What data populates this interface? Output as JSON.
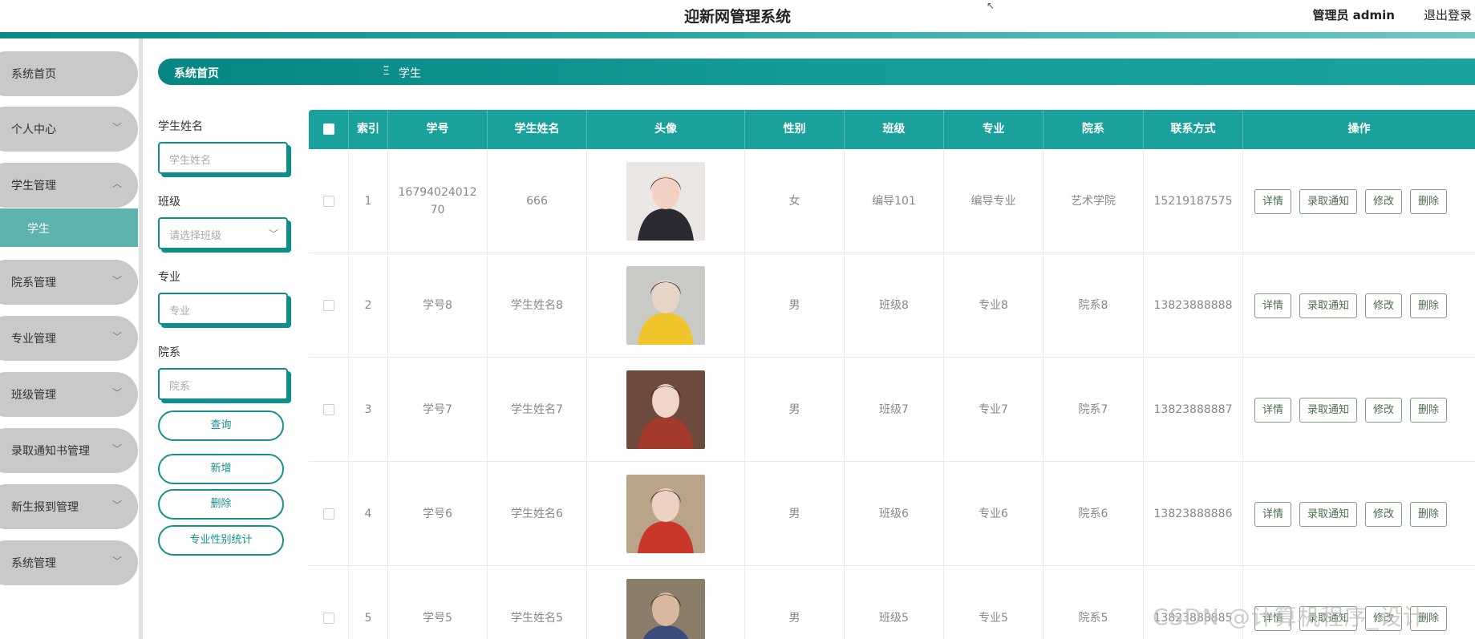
{
  "header": {
    "title": "迎新网管理系统",
    "user": "管理员 admin",
    "logout": "退出登录"
  },
  "sidebar": {
    "items": [
      {
        "label": "系统首页",
        "chevron": ""
      },
      {
        "label": "个人中心",
        "chevron": "﹀"
      },
      {
        "label": "学生管理",
        "chevron": "︿"
      },
      {
        "label": "院系管理",
        "chevron": "﹀"
      },
      {
        "label": "专业管理",
        "chevron": "﹀"
      },
      {
        "label": "班级管理",
        "chevron": "﹀"
      },
      {
        "label": "录取通知书管理",
        "chevron": "﹀"
      },
      {
        "label": "新生报到管理",
        "chevron": "﹀"
      },
      {
        "label": "系统管理",
        "chevron": "﹀"
      }
    ],
    "sub_active": "学生"
  },
  "breadcrumb": {
    "home": "系统首页",
    "sep": "Ξ",
    "current": "学生"
  },
  "search": {
    "name_label": "学生姓名",
    "name_placeholder": "学生姓名",
    "class_label": "班级",
    "class_placeholder": "请选择班级",
    "major_label": "专业",
    "major_placeholder": "专业",
    "dept_label": "院系",
    "dept_placeholder": "院系",
    "query_btn": "查询",
    "add_btn": "新增",
    "delete_btn": "删除",
    "stat_btn": "专业性别统计"
  },
  "table": {
    "headers": [
      "索引",
      "学号",
      "学生姓名",
      "头像",
      "性别",
      "班级",
      "专业",
      "院系",
      "联系方式",
      "操作"
    ],
    "actions": [
      "详情",
      "录取通知",
      "修改",
      "删除"
    ],
    "rows": [
      {
        "index": "1",
        "id": "1679402401270",
        "name": "666",
        "gender": "女",
        "class": "编导101",
        "major": "编导专业",
        "dept": "艺术学院",
        "phone": "15219187575"
      },
      {
        "index": "2",
        "id": "学号8",
        "name": "学生姓名8",
        "gender": "男",
        "class": "班级8",
        "major": "专业8",
        "dept": "院系8",
        "phone": "13823888888"
      },
      {
        "index": "3",
        "id": "学号7",
        "name": "学生姓名7",
        "gender": "男",
        "class": "班级7",
        "major": "专业7",
        "dept": "院系7",
        "phone": "13823888887"
      },
      {
        "index": "4",
        "id": "学号6",
        "name": "学生姓名6",
        "gender": "男",
        "class": "班级6",
        "major": "专业6",
        "dept": "院系6",
        "phone": "13823888886"
      },
      {
        "index": "5",
        "id": "学号5",
        "name": "学生姓名5",
        "gender": "男",
        "class": "班级5",
        "major": "专业5",
        "dept": "院系5",
        "phone": "13823888885"
      }
    ]
  },
  "watermark": "CSDN @计算机程序_设计",
  "colors": {
    "accent": "#1aa19c",
    "accent_dark": "#0b8a85",
    "sidebar_item": "#c9c9c9",
    "sidebar_active": "#5fb3ae"
  }
}
